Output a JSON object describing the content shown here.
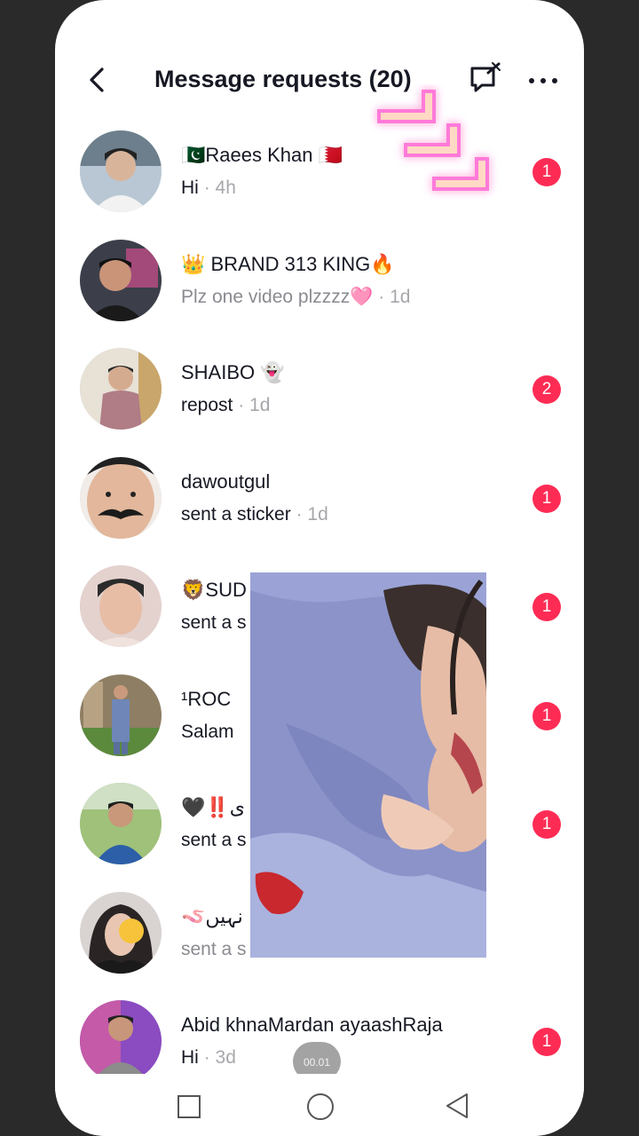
{
  "header": {
    "title": "Message requests (20)"
  },
  "requests": [
    {
      "name": "🇵🇰Raees Khan 🇧🇭",
      "message": "Hi",
      "time": "4h",
      "badge": "1",
      "dot": "·"
    },
    {
      "name": "👑 BRAND 313 KING🔥",
      "message": "Plz one video plzzzz🩷",
      "time": "1d",
      "badge": "",
      "dot": "·"
    },
    {
      "name": "SHAIBO 👻",
      "message": "repost",
      "time": "1d",
      "badge": "2",
      "dot": "·"
    },
    {
      "name": "dawoutgul",
      "message": "sent a sticker",
      "time": "1d",
      "badge": "1",
      "dot": "·"
    },
    {
      "name": "🦁SUD",
      "message": "sent a s",
      "time": "",
      "badge": "1",
      "dot": ""
    },
    {
      "name": "¹ROC",
      "message": "Salam",
      "time": "",
      "badge": "1",
      "dot": ""
    },
    {
      "name": "🖤‼️ی",
      "message": "sent a s",
      "time": "",
      "badge": "1",
      "dot": ""
    },
    {
      "name": "🪱نہیں",
      "message": "sent a s",
      "time": "",
      "badge": "",
      "dot": ""
    },
    {
      "name": "Abid khnaMardan ayaashRaja",
      "message": "Hi",
      "time": "3d",
      "badge": "1",
      "dot": "·"
    }
  ],
  "overlay": {
    "timer": "00.01"
  },
  "icons": {
    "back": "chevron-left-icon",
    "compose": "new-message-icon",
    "more": "ellipsis-icon"
  },
  "colors": {
    "badge": "#fe2c55",
    "text": "#161823",
    "muted": "#a6a7ab"
  }
}
